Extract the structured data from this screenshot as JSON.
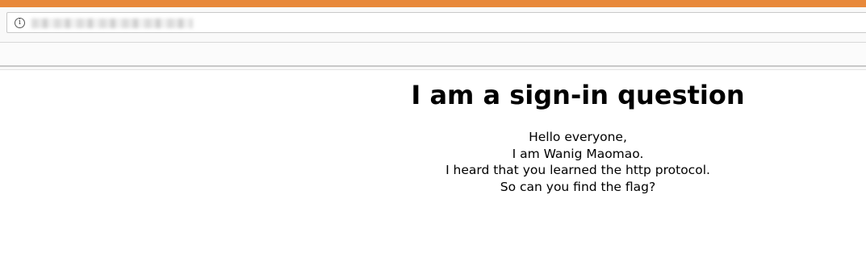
{
  "browser": {
    "accent_color": "#e8893a",
    "url_icon": "info-icon",
    "url_text": ""
  },
  "page": {
    "heading": "I am a sign-in question",
    "lines": [
      "Hello everyone,",
      "I am Wanig Maomao.",
      "I heard that you learned the http protocol.",
      "So can you find the flag?"
    ]
  }
}
